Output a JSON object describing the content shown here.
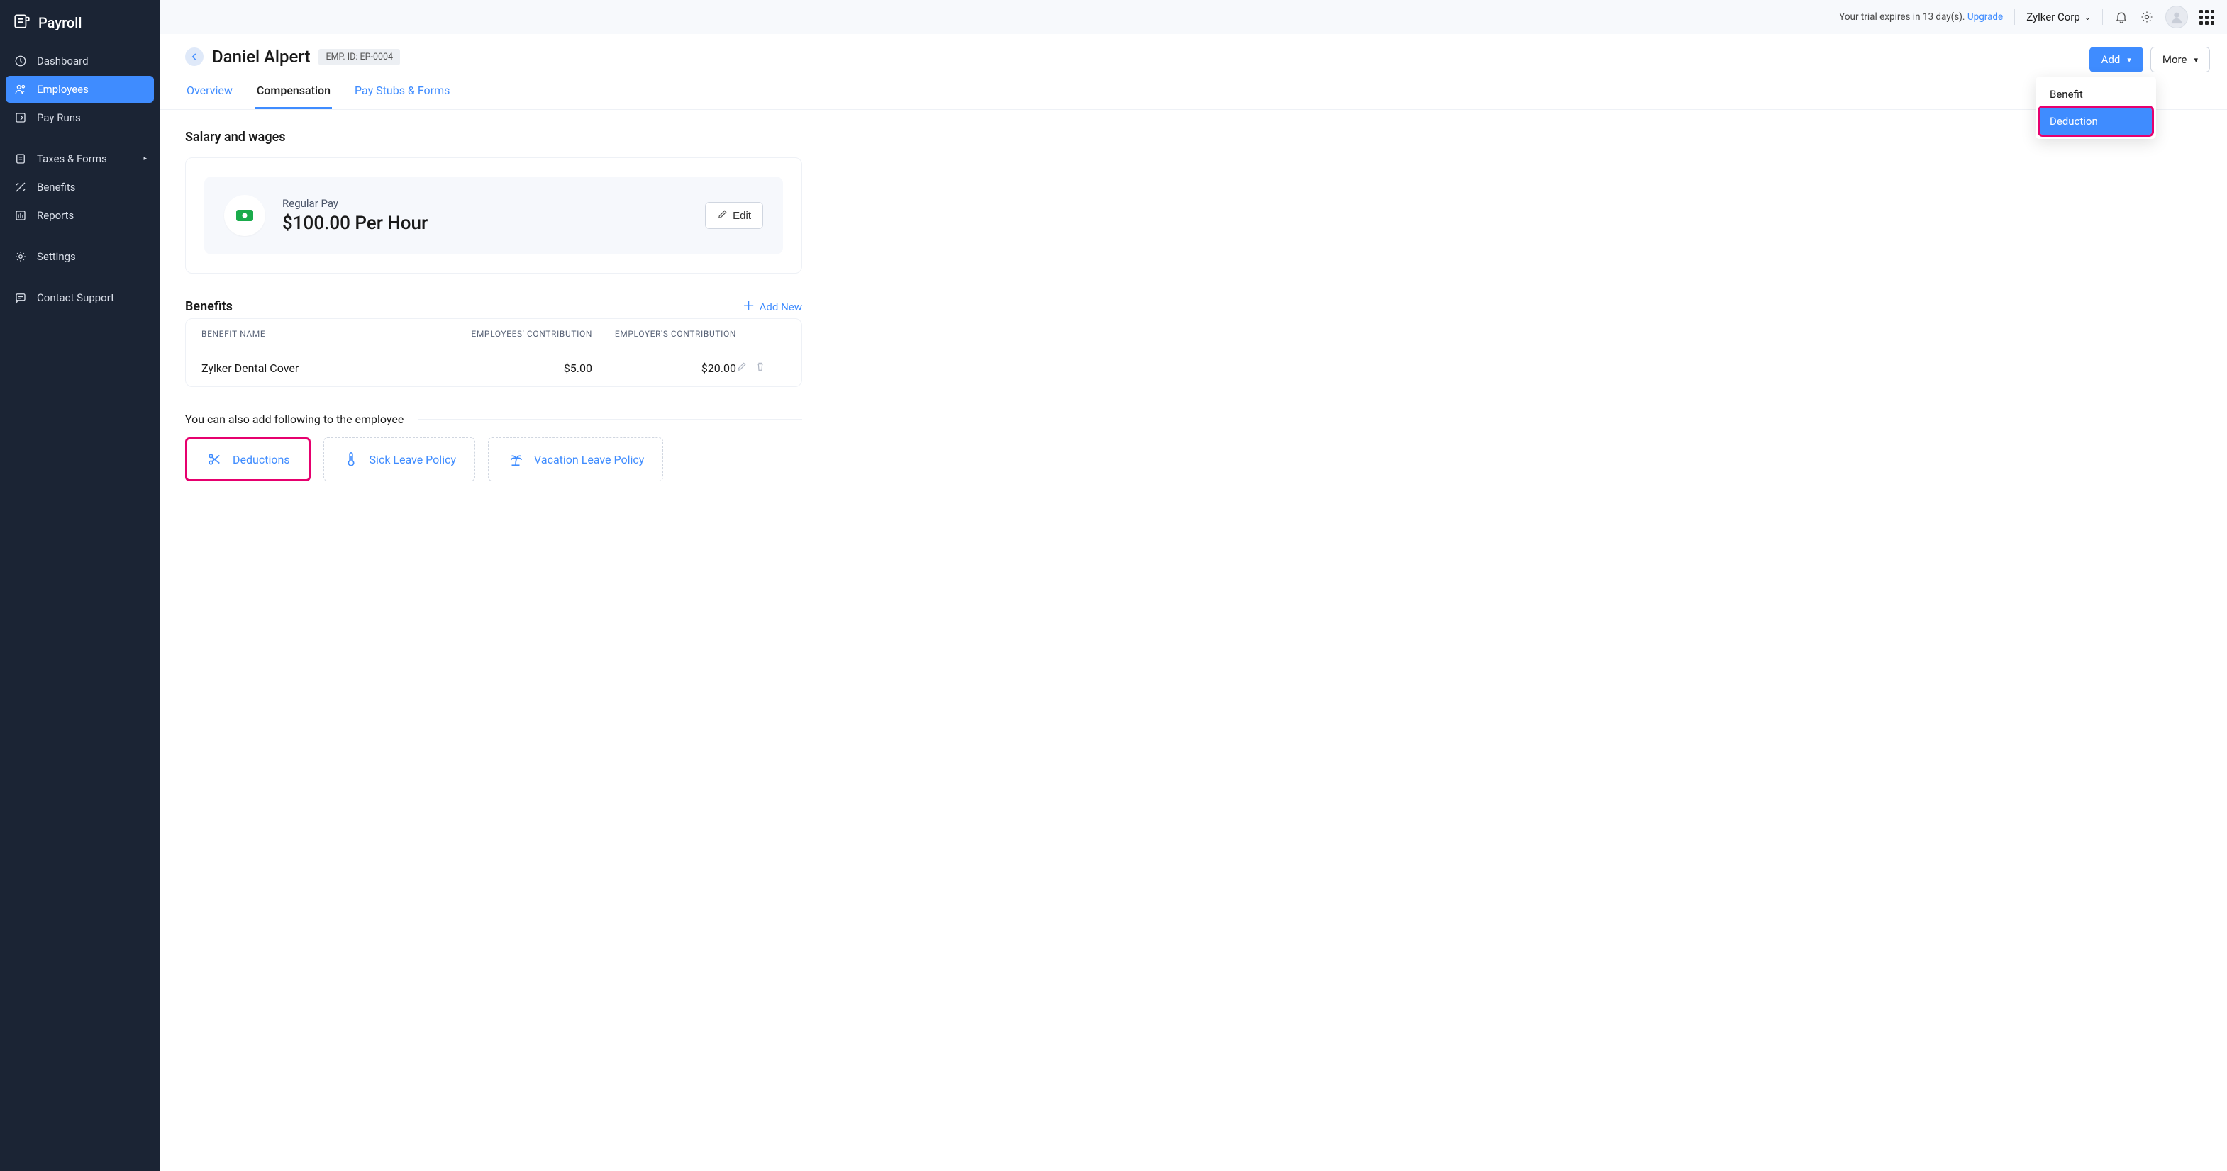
{
  "brand": "Payroll",
  "sidebar": {
    "items": [
      {
        "label": "Dashboard"
      },
      {
        "label": "Employees"
      },
      {
        "label": "Pay Runs"
      },
      {
        "label": "Taxes & Forms"
      },
      {
        "label": "Benefits"
      },
      {
        "label": "Reports"
      },
      {
        "label": "Settings"
      },
      {
        "label": "Contact Support"
      }
    ]
  },
  "topbar": {
    "trial_prefix": "Your trial expires in 13 day(s). ",
    "upgrade": "Upgrade",
    "org": "Zylker Corp"
  },
  "header": {
    "employee_name": "Daniel Alpert",
    "emp_id_badge": "EMP. ID: EP-0004",
    "add_btn": "Add",
    "more_btn": "More",
    "dropdown": {
      "benefit": "Benefit",
      "deduction": "Deduction"
    }
  },
  "tabs": {
    "overview": "Overview",
    "compensation": "Compensation",
    "paystubs": "Pay Stubs & Forms"
  },
  "salary": {
    "section": "Salary and wages",
    "label": "Regular Pay",
    "amount": "$100.00 Per Hour",
    "edit": "Edit"
  },
  "benefits": {
    "section": "Benefits",
    "add_new": "Add New",
    "cols": {
      "name": "BENEFIT NAME",
      "emp": "EMPLOYEES' CONTRIBUTION",
      "er": "EMPLOYER'S CONTRIBUTION"
    },
    "rows": [
      {
        "name": "Zylker Dental Cover",
        "emp": "$5.00",
        "er": "$20.00"
      }
    ]
  },
  "also": {
    "label": "You can also add following to the employee",
    "chips": {
      "deductions": "Deductions",
      "sick": "Sick Leave Policy",
      "vacation": "Vacation Leave Policy"
    }
  }
}
